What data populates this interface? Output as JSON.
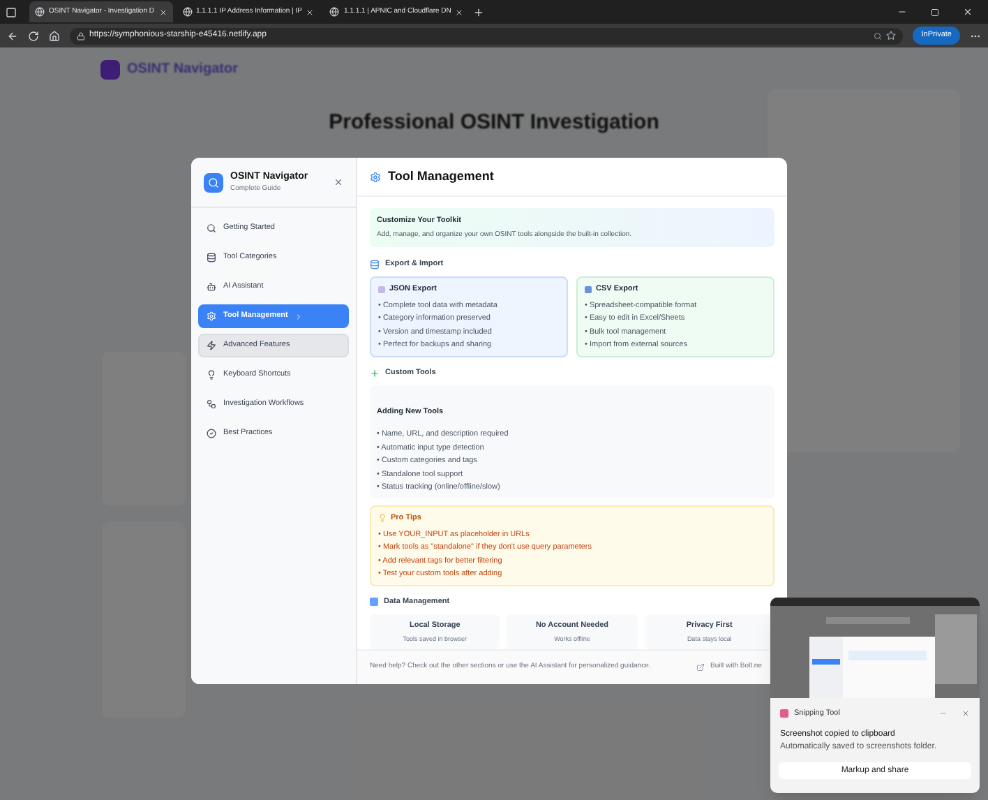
{
  "browser": {
    "tabs": [
      {
        "title": "OSINT Navigator - Investigation D",
        "selected": true
      },
      {
        "title": "1.1.1.1 IP Address Information | IP",
        "selected": false
      },
      {
        "title": "1.1.1.1 | APNIC and Cloudflare DN",
        "selected": false
      }
    ],
    "url": "https://symphonious-starship-e45416.netlify.app",
    "profile": "InPrivate"
  },
  "background_page": {
    "brand": "OSINT Navigator",
    "heading": "Professional OSINT Investigation"
  },
  "guide": {
    "title": "OSINT Navigator",
    "subtitle": "Complete Guide",
    "nav": [
      {
        "kind": "search",
        "label": "Getting Started",
        "selected": false,
        "highlighted": false
      },
      {
        "kind": "database",
        "label": "Tool Categories",
        "selected": false,
        "highlighted": false
      },
      {
        "kind": "bot",
        "label": "AI Assistant",
        "selected": false,
        "highlighted": false
      },
      {
        "kind": "settings",
        "label": "Tool Management",
        "selected": true,
        "highlighted": false
      },
      {
        "kind": "zap",
        "label": "Advanced Features",
        "selected": false,
        "highlighted": true
      },
      {
        "kind": "bulb",
        "label": "Keyboard Shortcuts",
        "selected": false,
        "highlighted": false
      },
      {
        "kind": "workflow",
        "label": "Investigation Workflows",
        "selected": false,
        "highlighted": false
      },
      {
        "kind": "check",
        "label": "Best Practices",
        "selected": false,
        "highlighted": false
      }
    ],
    "section_title": "Tool Management",
    "intro": {
      "title": "Customize Your Toolkit",
      "text": "Add, manage, and organize your own OSINT tools alongside the built-in collection."
    },
    "export_heading": "Export & Import",
    "export_cards": [
      {
        "kind": "json",
        "title": "JSON Export",
        "items": [
          "• Complete tool data with metadata",
          "• Category information preserved",
          "• Version and timestamp included",
          "• Perfect for backups and sharing"
        ]
      },
      {
        "kind": "csv",
        "title": "CSV Export",
        "items": [
          "• Spreadsheet-compatible format",
          "• Easy to edit in Excel/Sheets",
          "• Bulk tool management",
          "• Import from external sources"
        ]
      }
    ],
    "custom_heading": "Custom Tools",
    "adding": {
      "title": "Adding New Tools",
      "items": [
        "• Name, URL, and description required",
        "• Automatic input type detection",
        "• Custom categories and tags",
        "• Standalone tool support",
        "• Status tracking (online/offline/slow)"
      ]
    },
    "tips": {
      "title": "Pro Tips",
      "items": [
        "• Use YOUR_INPUT as placeholder in URLs",
        "• Mark tools as \"standalone\" if they don't use query parameters",
        "• Add relevant tags for better filtering",
        "• Test your custom tools after adding"
      ]
    },
    "data_heading": "Data Management",
    "data_cards": [
      {
        "title": "Local Storage",
        "text": "Tools saved in browser"
      },
      {
        "title": "No Account Needed",
        "text": "Works offline"
      },
      {
        "title": "Privacy First",
        "text": "Data stays local"
      }
    ],
    "footer": "Need help? Check out the other sections or use the AI Assistant for personalized guidance.",
    "built_with": "Built with Bolt.ne"
  },
  "toast": {
    "app": "Snipping Tool",
    "title": "Screenshot copied to clipboard",
    "text": "Automatically saved to screenshots folder.",
    "action": "Markup and share"
  }
}
